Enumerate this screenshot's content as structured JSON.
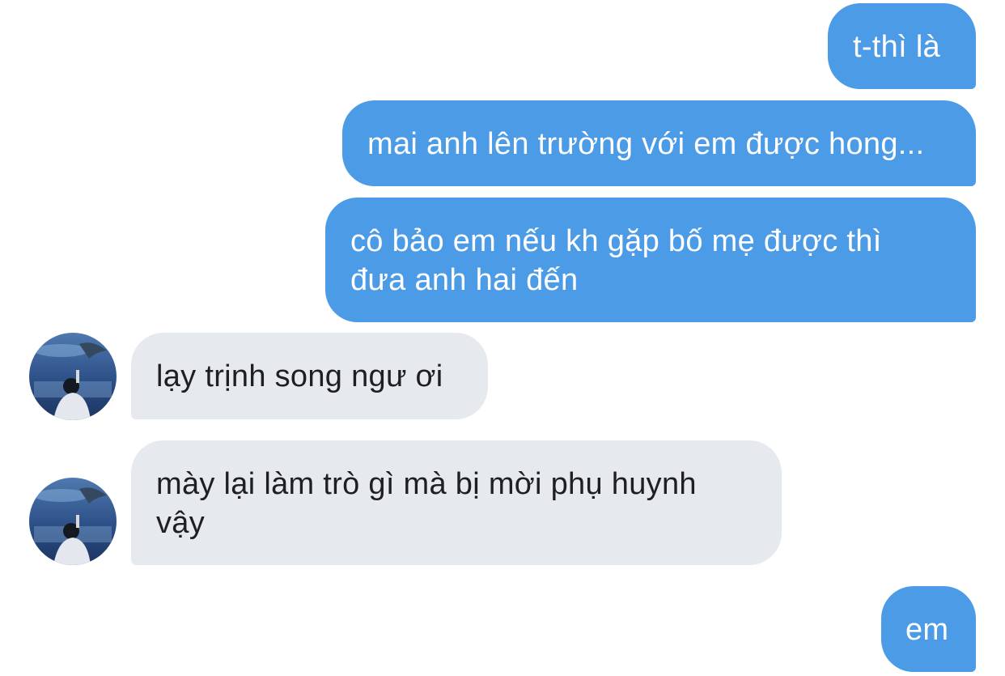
{
  "messages": [
    {
      "sender": "me",
      "text": "t-thì là"
    },
    {
      "sender": "me",
      "text": "mai anh lên trường với em được hong..."
    },
    {
      "sender": "me",
      "lines": [
        "cô bảo em nếu kh gặp bố mẹ được thì",
        "đưa anh hai đến"
      ]
    },
    {
      "sender": "other",
      "text": "lạy trịnh song ngư ơi"
    },
    {
      "sender": "other",
      "lines": [
        "mày lại làm trò gì mà bị mời phụ huynh",
        "vậy"
      ]
    },
    {
      "sender": "me",
      "text": "em"
    }
  ],
  "colors": {
    "outgoing_bubble": "#4b9be6",
    "incoming_bubble": "#e6e9ed"
  }
}
